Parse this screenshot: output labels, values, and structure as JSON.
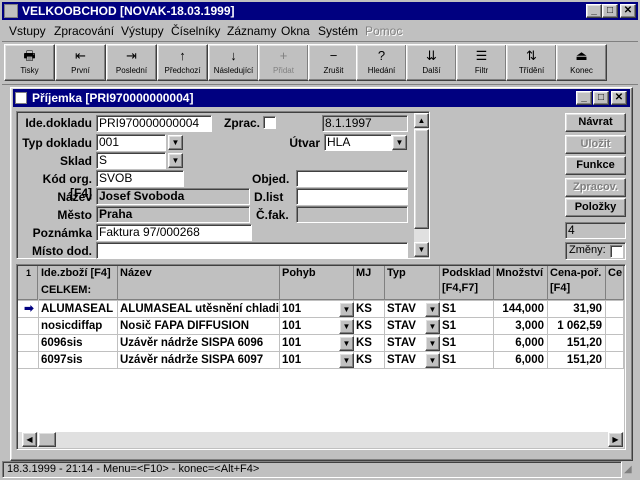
{
  "app": {
    "title": "VELKOOBCHOD [NOVAK-18.03.1999]"
  },
  "menu": [
    "Vstupy",
    "Zpracování",
    "Výstupy",
    "Číselníky",
    "Záznamy",
    "Okna",
    "Systém",
    "Pomoc"
  ],
  "toolbar": [
    {
      "label": "Tisky",
      "icon": "printer-icon",
      "glyph": "🖶"
    },
    {
      "label": "První",
      "icon": "first-record-icon",
      "glyph": "⇤"
    },
    {
      "label": "Poslední",
      "icon": "last-record-icon",
      "glyph": "⇥"
    },
    {
      "label": "Předchozí",
      "icon": "previous-record-icon",
      "glyph": "↑"
    },
    {
      "label": "Následující",
      "icon": "next-record-icon",
      "glyph": "↓"
    },
    {
      "label": "Přidat",
      "icon": "add-record-icon",
      "glyph": "+"
    },
    {
      "label": "Zrušit",
      "icon": "delete-record-icon",
      "glyph": "−"
    },
    {
      "label": "Hledání",
      "icon": "search-icon",
      "glyph": "?"
    },
    {
      "label": "Další",
      "icon": "find-next-icon",
      "glyph": "⇊"
    },
    {
      "label": "Filtr",
      "icon": "filter-icon",
      "glyph": "☰"
    },
    {
      "label": "Třídění",
      "icon": "sort-icon",
      "glyph": "⇅"
    },
    {
      "label": "Konec",
      "icon": "exit-icon",
      "glyph": "⏏"
    }
  ],
  "child": {
    "title": "Příjemka [PRI970000000004]"
  },
  "form": {
    "ide_label": "Ide.dokladu",
    "ide_value": "PRI970000000004",
    "zprac_label": "Zprac.",
    "date_value": "8.1.1997",
    "typ_label": "Typ dokladu",
    "typ_value": "001",
    "utvar_label": "Útvar",
    "utvar_value": "HLA",
    "sklad_label": "Sklad",
    "sklad_value": "S",
    "kod_label": "Kód org.[F4]",
    "kod_value": "SVOB",
    "objed_label": "Objed.",
    "objed_value": "",
    "nazev_label": "Název",
    "nazev_value": "Josef Svoboda",
    "dlist_label": "D.list",
    "dlist_value": "",
    "mesto_label": "Město",
    "mesto_value": "Praha",
    "cfak_label": "Č.fak.",
    "cfak_value": "",
    "poznamka_label": "Poznámka",
    "poznamka_value": "Faktura 97/000268",
    "misto_label": "Místo dod.",
    "misto_value": ""
  },
  "side_buttons": [
    {
      "label": "Návrat",
      "enabled": true
    },
    {
      "label": "Uložit",
      "enabled": false
    },
    {
      "label": "Funkce",
      "enabled": true
    },
    {
      "label": "Zpracov.",
      "enabled": false
    },
    {
      "label": "Položky",
      "enabled": true
    }
  ],
  "counter": "4",
  "zmeny_label": "Změny:",
  "grid": {
    "row_marker_header": "1",
    "headers": [
      "Ide.zboží [F4]",
      "Název",
      "Pohyb",
      "MJ",
      "Typ",
      "Podsklad [F4,F7]",
      "Množství",
      "Cena-poř. [F4]",
      "Ce"
    ],
    "celkem_label": "CELKEM:",
    "rows": [
      [
        "ALUMASEAL",
        "ALUMASEAL utěsnění chladi",
        "101",
        "KS",
        "STAV",
        "S1",
        "144,000",
        "31,90"
      ],
      [
        "nosicdiffap",
        "Nosič FAPA DIFFUSION",
        "101",
        "KS",
        "STAV",
        "S1",
        "3,000",
        "1 062,59"
      ],
      [
        "6096sis",
        "Uzávěr nádrže SISPA 6096",
        "101",
        "KS",
        "STAV",
        "S1",
        "6,000",
        "151,20"
      ],
      [
        "6097sis",
        "Uzávěr nádrže SISPA 6097",
        "101",
        "KS",
        "STAV",
        "S1",
        "6,000",
        "151,20"
      ]
    ]
  },
  "status": "18.3.1999 - 21:14 - Menu=<F10> - konec=<Alt+F4>"
}
